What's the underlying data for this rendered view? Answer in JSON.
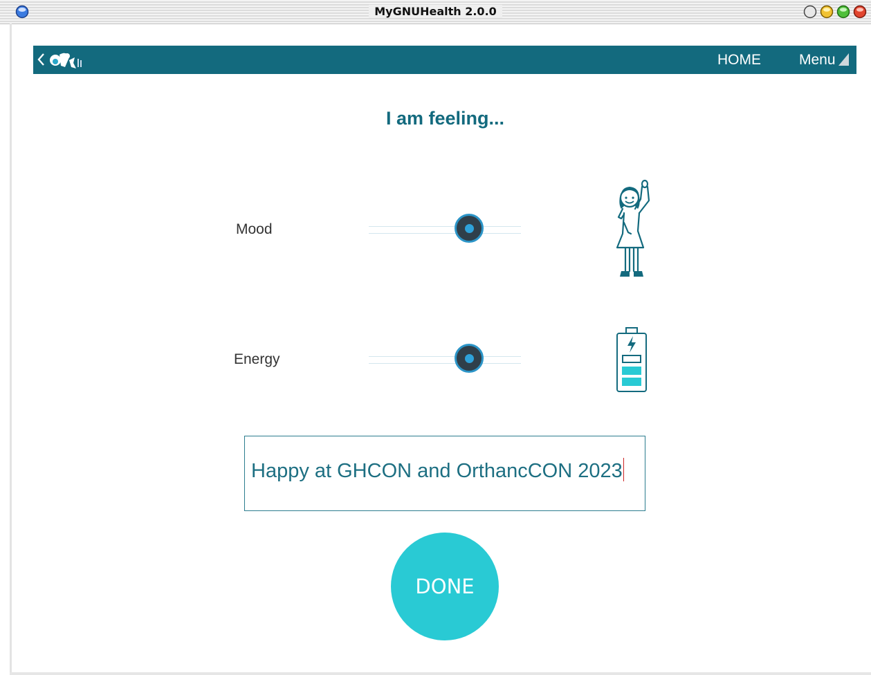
{
  "window": {
    "title": "MyGNUHealth 2.0.0"
  },
  "header": {
    "home_label": "HOME",
    "menu_label": "Menu"
  },
  "page": {
    "heading": "I am feeling..."
  },
  "sliders": {
    "mood": {
      "label": "Mood",
      "value_fraction": 0.66
    },
    "energy": {
      "label": "Energy",
      "value_fraction": 0.66
    }
  },
  "note": {
    "value": "Happy at GHCON and OrthancCON 2023"
  },
  "actions": {
    "done_label": "DONE"
  },
  "icons": {
    "back": "chevron-left-icon",
    "logo": "mygnuhealth-logo",
    "menu_indicator": "triangle-icon",
    "mood": "happy-person-icon",
    "energy": "battery-charging-icon"
  },
  "colors": {
    "header_bg": "#136a7e",
    "accent": "#29cad4",
    "slider_handle": "#2f3f4a",
    "slider_ring": "#2c95c8",
    "text_teal": "#1d6f82"
  }
}
